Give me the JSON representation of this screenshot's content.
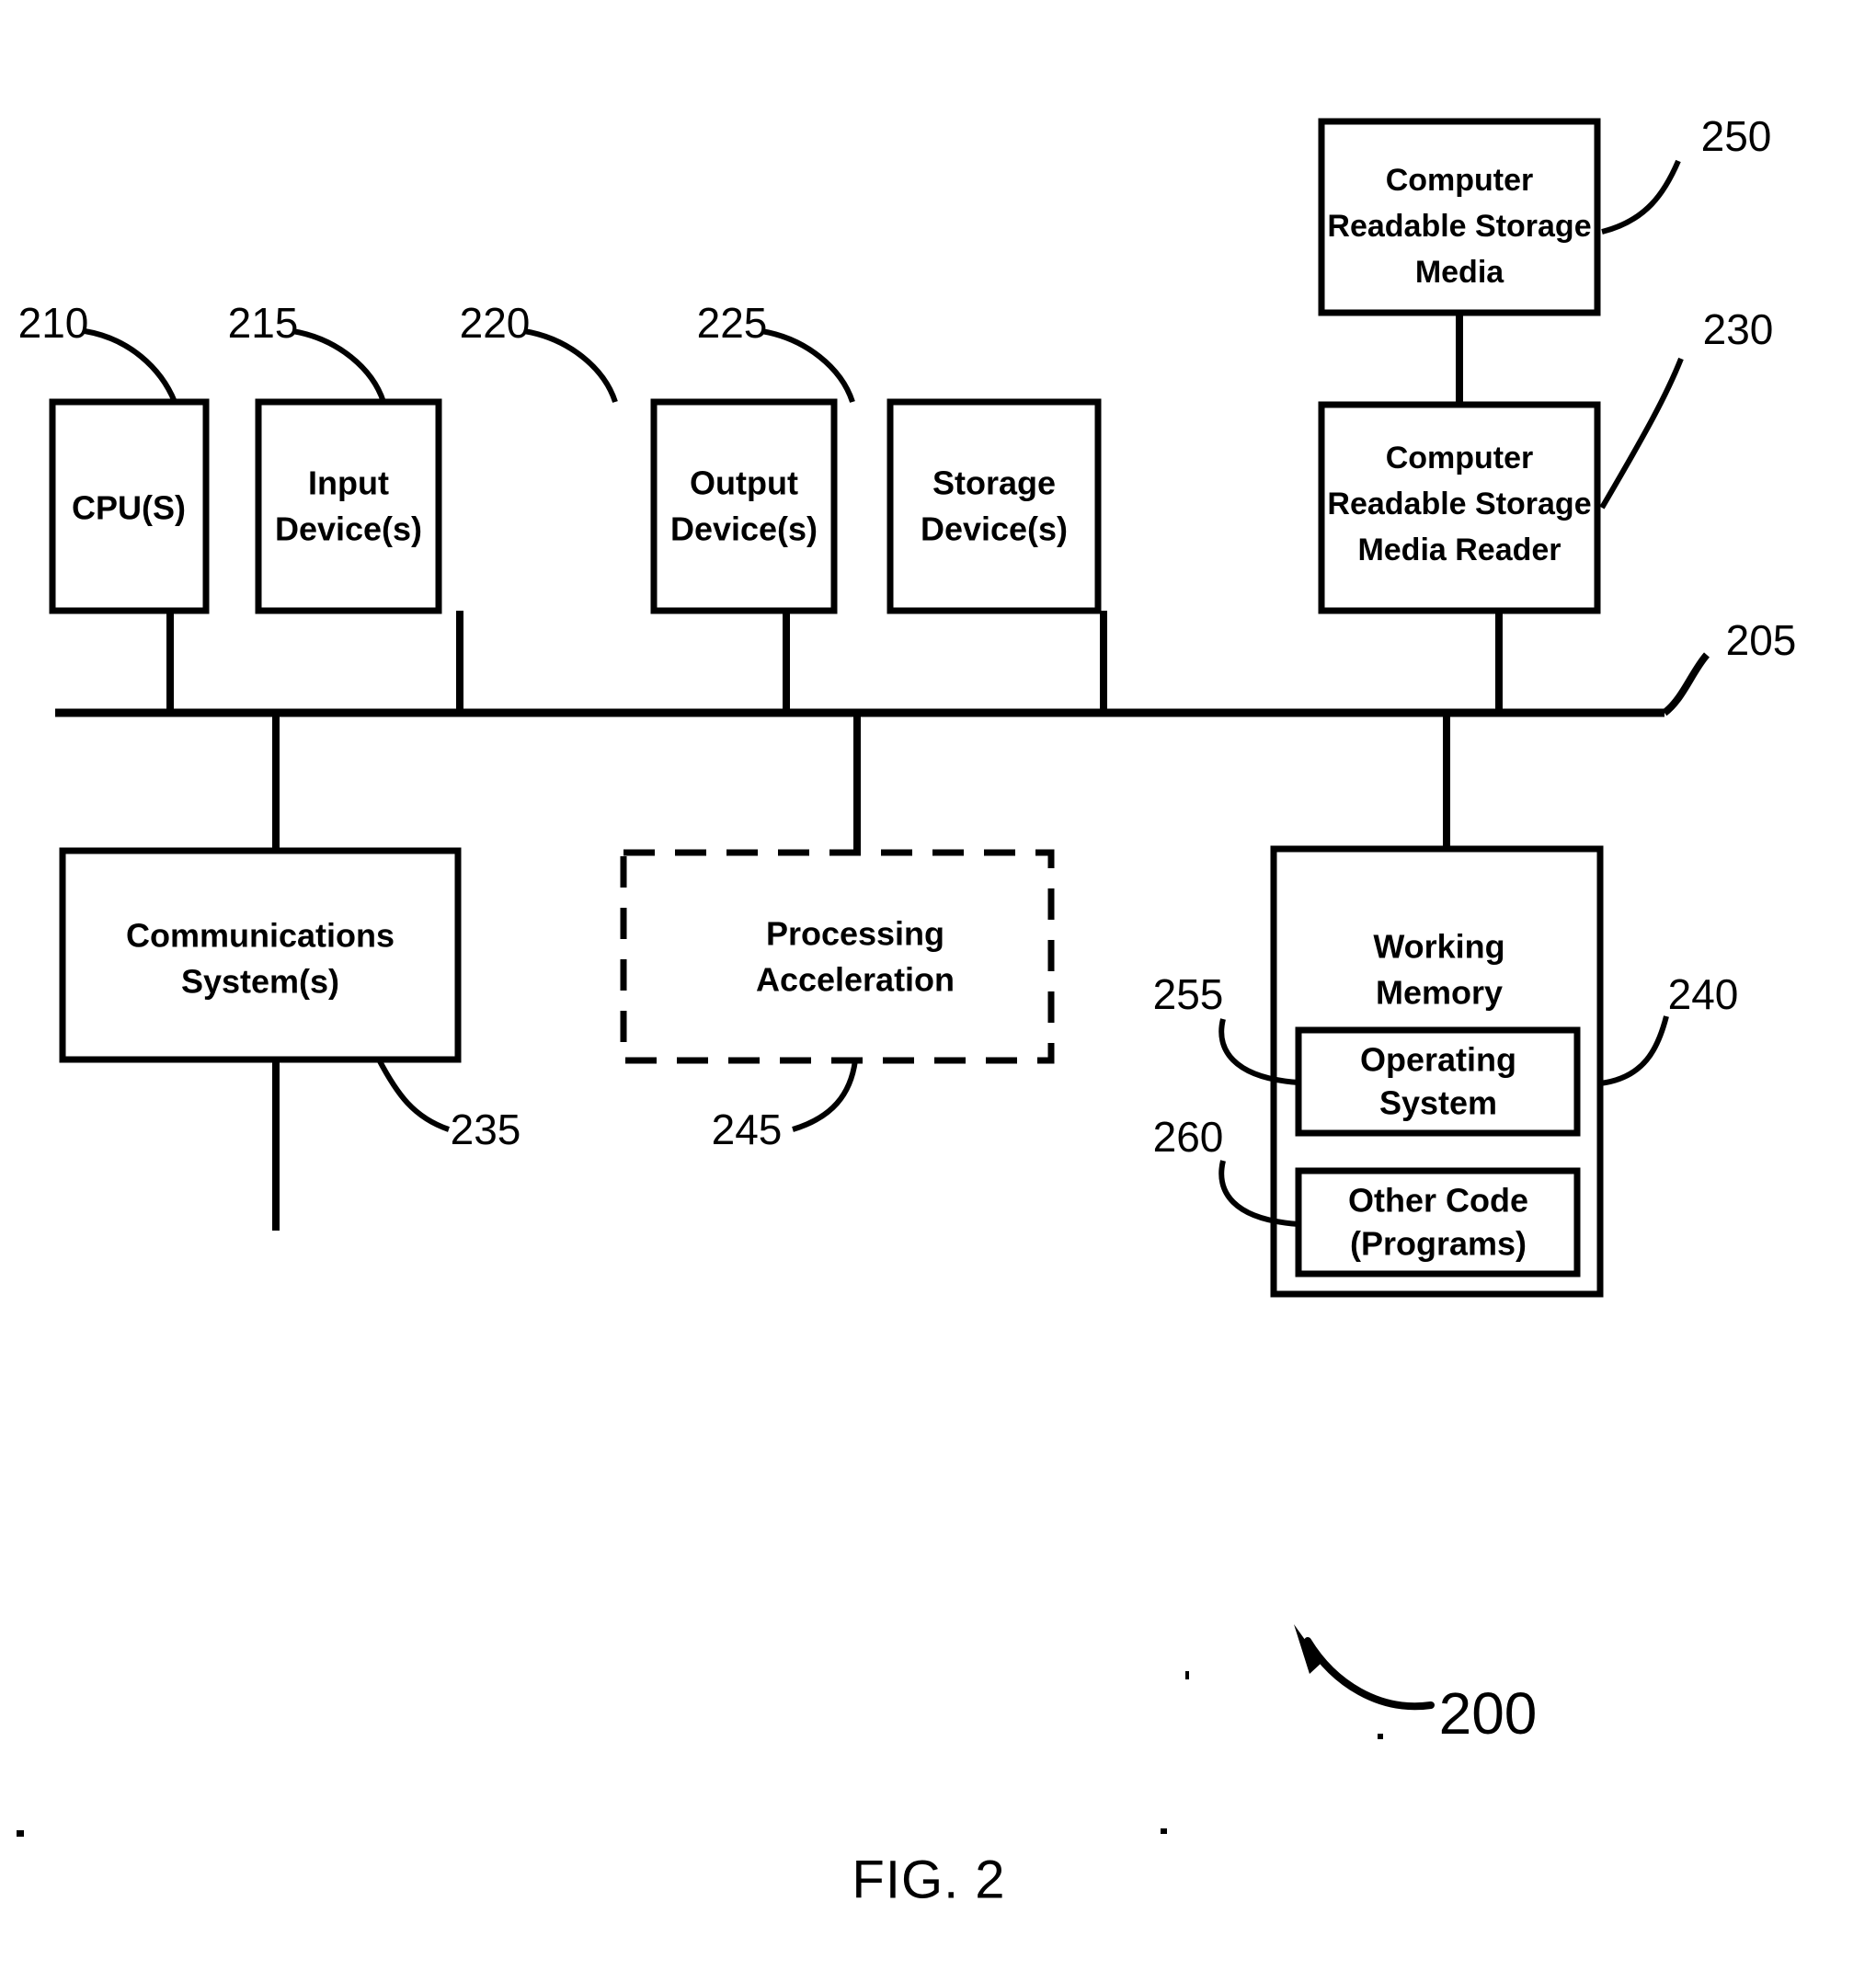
{
  "figure": {
    "caption": "FIG. 2",
    "system_ref": "200"
  },
  "nodes": [
    {
      "id": "cpu",
      "ref": "210",
      "lines": [
        "CPU(S)"
      ]
    },
    {
      "id": "input",
      "ref": "215",
      "lines": [
        "Input",
        "Device(s)"
      ]
    },
    {
      "id": "output",
      "ref": "220",
      "lines": [
        "Output",
        "Device(s)"
      ]
    },
    {
      "id": "storage",
      "ref": "225",
      "lines": [
        "Storage",
        "Device(s)"
      ]
    },
    {
      "id": "crsm-reader",
      "ref": "230",
      "lines": [
        "Computer",
        "Readable Storage",
        "Media Reader"
      ]
    },
    {
      "id": "crsm",
      "ref": "250",
      "lines": [
        "Computer",
        "Readable Storage",
        "Media"
      ]
    },
    {
      "id": "comms",
      "ref": "235",
      "lines": [
        "Communications",
        "System(s)"
      ]
    },
    {
      "id": "procaccel",
      "ref": "245",
      "lines": [
        "Processing",
        "Acceleration"
      ],
      "style": "dashed"
    },
    {
      "id": "workmem",
      "ref": "240",
      "lines": [
        "Working",
        "Memory"
      ]
    },
    {
      "id": "os",
      "ref": "255",
      "lines": [
        "Operating",
        "System"
      ]
    },
    {
      "id": "othercode",
      "ref": "260",
      "lines": [
        "Other Code",
        "(Programs)"
      ]
    }
  ],
  "bus": {
    "ref": "205"
  },
  "refs": {
    "r210": "210",
    "r215": "215",
    "r220": "220",
    "r225": "225",
    "r230": "230",
    "r235": "235",
    "r240": "240",
    "r245": "245",
    "r250": "250",
    "r255": "255",
    "r260": "260",
    "r205": "205",
    "r200": "200"
  },
  "labels": {
    "cpu_l1": "CPU(S)",
    "input_l1": "Input",
    "input_l2": "Device(s)",
    "output_l1": "Output",
    "output_l2": "Device(s)",
    "storage_l1": "Storage",
    "storage_l2": "Device(s)",
    "reader_l1": "Computer",
    "reader_l2": "Readable Storage",
    "reader_l3": "Media Reader",
    "media_l1": "Computer",
    "media_l2": "Readable Storage",
    "media_l3": "Media",
    "comms_l1": "Communications",
    "comms_l2": "System(s)",
    "accel_l1": "Processing",
    "accel_l2": "Acceleration",
    "wm_l1": "Working",
    "wm_l2": "Memory",
    "os_l1": "Operating",
    "os_l2": "System",
    "oc_l1": "Other Code",
    "oc_l2": "(Programs)",
    "caption": "FIG. 2"
  },
  "colors": {
    "ink": "#000000",
    "paper": "#ffffff"
  }
}
